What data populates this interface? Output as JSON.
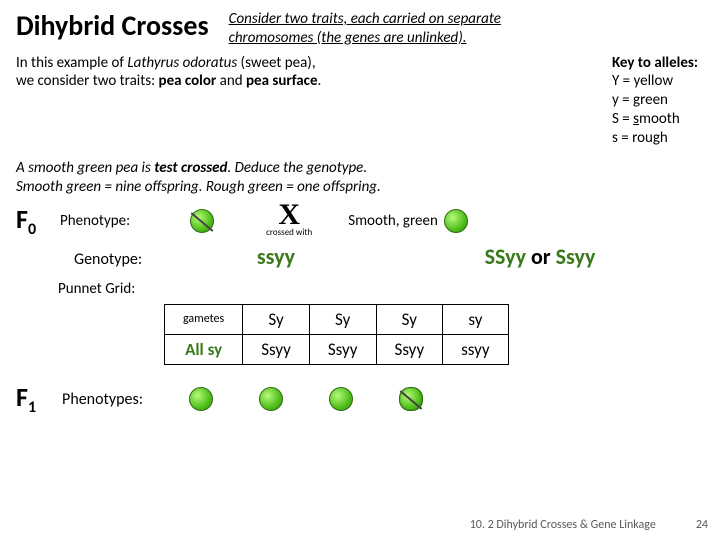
{
  "title": "Dihybrid Crosses",
  "subtitle_l1": "Consider two traits, each carried on separate",
  "subtitle_l2": "chromosomes (the genes are unlinked).",
  "intro_l1a": "In this example of ",
  "intro_l1b": "Lathyrus odoratus",
  "intro_l1c": " (sweet pea),",
  "intro_l2a": "we consider two traits: ",
  "intro_l2b": "pea color",
  "intro_l2c": " and ",
  "intro_l2d": "pea surface",
  "intro_l2e": ".",
  "key_title": "Key to alleles:",
  "key_Y": "Y = yellow",
  "key_y": "y = green",
  "key_S_pre": "S = ",
  "key_S_u": "s",
  "key_S_post": "mooth",
  "key_s": "s = rough",
  "deduce_l1a": "A smooth green pea is ",
  "deduce_l1b": "test crossed",
  "deduce_l1c": ". Deduce the genotype.",
  "deduce_l2": "Smooth green = nine offspring. Rough green = one offspring.",
  "F0": "F",
  "F0s": "0",
  "F1": "F",
  "F1s": "1",
  "phen_label": "Phenotype:",
  "geno_label": "Genotype:",
  "grid_label": "Punnet Grid:",
  "phen_right": "Smooth, green",
  "geno_left": "ssyy",
  "geno_right_a": "SSyy ",
  "geno_right_b": "or",
  "geno_right_c": " Ssyy",
  "cross_small": "crossed with",
  "punnett": {
    "corner": "gametes",
    "top": [
      "Sy",
      "Sy",
      "Sy",
      "sy"
    ],
    "left": "All sy",
    "cells": [
      "Ssyy",
      "Ssyy",
      "Ssyy",
      "ssyy"
    ]
  },
  "f1_label": "Phenotypes:",
  "footer_text": "10. 2 Dihybrid Crosses & Gene Linkage",
  "footer_page": "24"
}
